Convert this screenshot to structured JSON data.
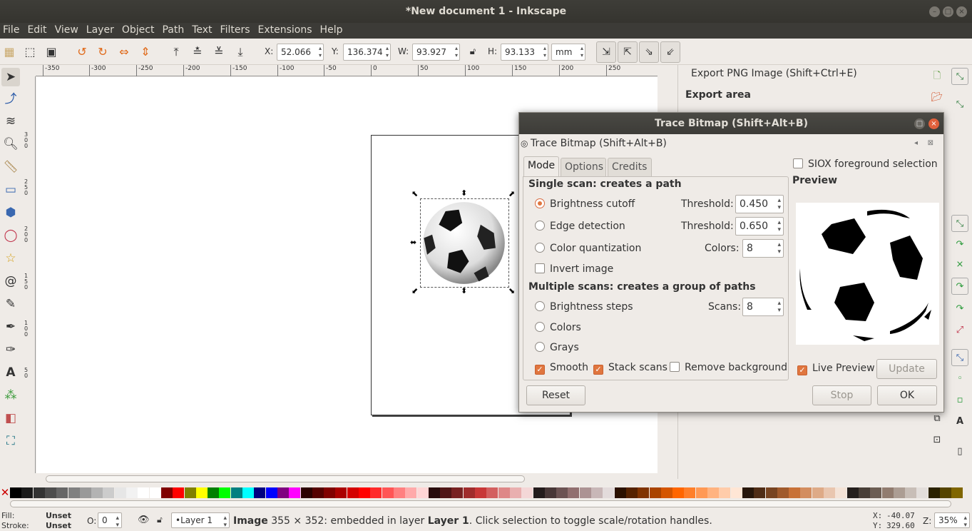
{
  "window": {
    "title": "*New document 1 - Inkscape"
  },
  "menu": [
    "File",
    "Edit",
    "View",
    "Layer",
    "Object",
    "Path",
    "Text",
    "Filters",
    "Extensions",
    "Help"
  ],
  "toolbar": {
    "x_label": "X:",
    "x": "52.066",
    "y_label": "Y:",
    "y": "136.374",
    "w_label": "W:",
    "w": "93.927",
    "h_label": "H:",
    "h": "93.133",
    "unit": "mm"
  },
  "ruler": {
    "top": [
      "-350",
      "-300",
      "-250",
      "-200",
      "-150",
      "-100",
      "-50",
      "0",
      "50",
      "100",
      "150",
      "200",
      "250"
    ],
    "left": [
      "3\n0\n0",
      "2\n5\n0",
      "2\n0\n0",
      "1\n5\n0",
      "1\n0\n0",
      "5\n0"
    ]
  },
  "export_panel": {
    "title": "Export PNG Image (Shift+Ctrl+E)",
    "export_area": "Export area"
  },
  "dialog": {
    "title": "Trace Bitmap (Shift+Alt+B)",
    "subtitle": "Trace Bitmap (Shift+Alt+B)",
    "tabs": [
      "Mode",
      "Options",
      "Credits"
    ],
    "single_scan": "Single scan: creates a path",
    "brightness_cutoff": "Brightness cutoff",
    "edge_detection": "Edge detection",
    "color_quantization": "Color quantization",
    "invert_image": "Invert image",
    "threshold_label": "Threshold:",
    "threshold1": "0.450",
    "threshold2": "0.650",
    "colors_label": "Colors:",
    "colors_value": "8",
    "multiple_scans": "Multiple scans: creates a group of paths",
    "brightness_steps": "Brightness steps",
    "scans_label": "Scans:",
    "scans_value": "8",
    "colors": "Colors",
    "grays": "Grays",
    "smooth": "Smooth",
    "stack_scans": "Stack scans",
    "remove_background": "Remove background",
    "siox": "SIOX foreground selection",
    "preview": "Preview",
    "live_preview": "Live Preview",
    "update": "Update",
    "reset": "Reset",
    "stop": "Stop",
    "ok": "OK"
  },
  "status": {
    "fill_label": "Fill:",
    "fill": "Unset",
    "stroke_label": "Stroke:",
    "stroke": "Unset",
    "opacity_label": "O:",
    "opacity": "0",
    "layer": "•Layer 1",
    "message_bold": "Image",
    "message": " 355 × 352: embedded in layer ",
    "message_layer": "Layer 1",
    "message_end": ". Click selection to toggle scale/rotation handles.",
    "x_label": "X:",
    "x": "-40.07",
    "y_label": "Y:",
    "y": "329.60",
    "z_label": "Z:",
    "zoom": "35%"
  },
  "palette": [
    "#000000",
    "#1a1a1a",
    "#333333",
    "#4d4d4d",
    "#666666",
    "#808080",
    "#999999",
    "#b3b3b3",
    "#cccccc",
    "#e6e6e6",
    "#f2f2f2",
    "#ffffff",
    "#ffffff",
    "#800000",
    "#ff0000",
    "#808000",
    "#ffff00",
    "#008000",
    "#00ff00",
    "#008080",
    "#00ffff",
    "#000080",
    "#0000ff",
    "#800080",
    "#ff00ff",
    "#2b0000",
    "#550000",
    "#800000",
    "#aa0000",
    "#d40000",
    "#ff0000",
    "#ff2a2a",
    "#ff5555",
    "#ff8080",
    "#ffaaaa",
    "#ffd5d5",
    "#280b0b",
    "#501616",
    "#782121",
    "#a02c2c",
    "#c83737",
    "#d35f5f",
    "#de8787",
    "#e9afaf",
    "#f4d7d7",
    "#241c1c",
    "#483737",
    "#6c5353",
    "#916f6f",
    "#ac9393",
    "#c8b7b7",
    "#e3dbdb",
    "#2b1100",
    "#552200",
    "#803300",
    "#aa4400",
    "#d45500",
    "#ff6600",
    "#ff7f2a",
    "#ff9955",
    "#ffb380",
    "#ffccaa",
    "#ffe6d5",
    "#28170b",
    "#502d16",
    "#784421",
    "#a05a2c",
    "#c87137",
    "#d38d5f",
    "#deaa87",
    "#e9c6af",
    "#f4e3d7",
    "#241f1c",
    "#483e37",
    "#6c5d53",
    "#917c6f",
    "#ac9d93",
    "#c8beb7",
    "#e3dedb",
    "#2b2200",
    "#554400",
    "#806600"
  ]
}
